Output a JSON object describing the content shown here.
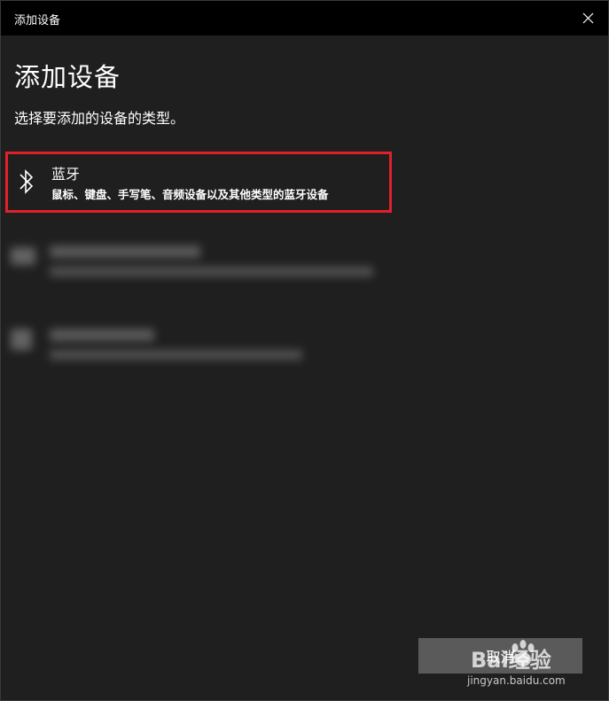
{
  "window": {
    "title": "添加设备",
    "close_icon": "close-icon"
  },
  "main": {
    "heading": "添加设备",
    "subtitle": "选择要添加的设备的类型。"
  },
  "options": [
    {
      "name": "蓝牙",
      "description": "鼠标、键盘、手写笔、音频设备以及其他类型的蓝牙设备",
      "icon": "bluetooth-icon",
      "highlight_color": "#e0202a"
    }
  ],
  "footer": {
    "cancel_label": "取消"
  },
  "watermark": {
    "brand": "Bai经验",
    "url": "jingyan.baidu.com"
  },
  "colors": {
    "background": "#1f1f1f",
    "titlebar": "#000000",
    "button": "#5a5a5a",
    "highlight": "#e0202a"
  }
}
